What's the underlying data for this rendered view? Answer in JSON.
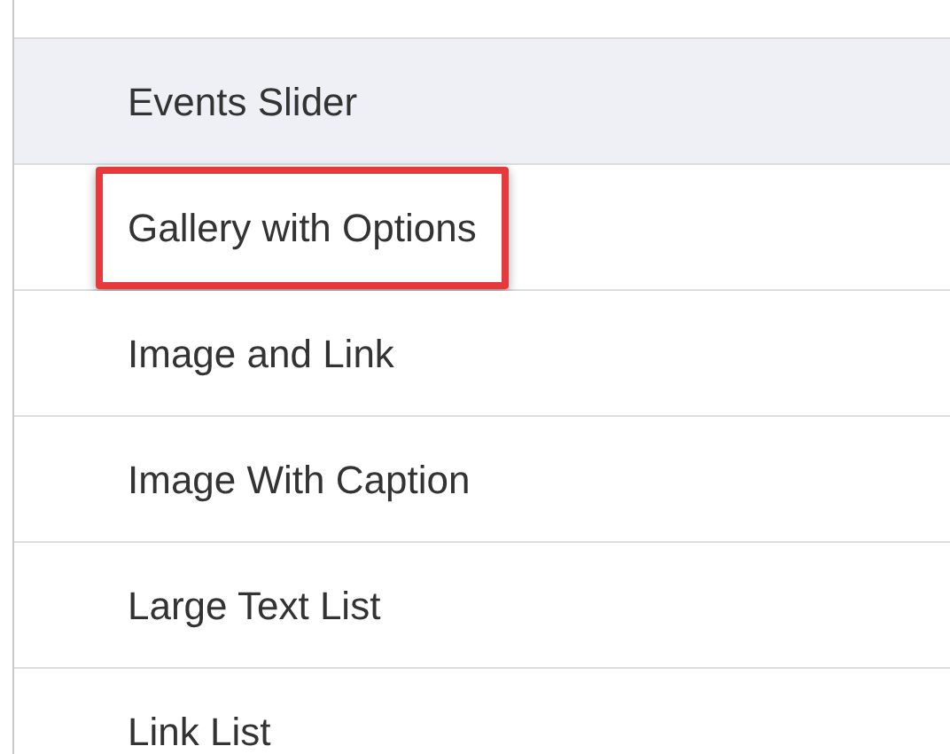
{
  "items": [
    {
      "label": "Events Slider",
      "selected": true,
      "highlighted": false
    },
    {
      "label": "Gallery with Options",
      "selected": false,
      "highlighted": true
    },
    {
      "label": "Image and Link",
      "selected": false,
      "highlighted": false
    },
    {
      "label": "Image With Caption",
      "selected": false,
      "highlighted": false
    },
    {
      "label": "Large Text List",
      "selected": false,
      "highlighted": false
    },
    {
      "label": "Link List",
      "selected": false,
      "highlighted": false
    }
  ]
}
